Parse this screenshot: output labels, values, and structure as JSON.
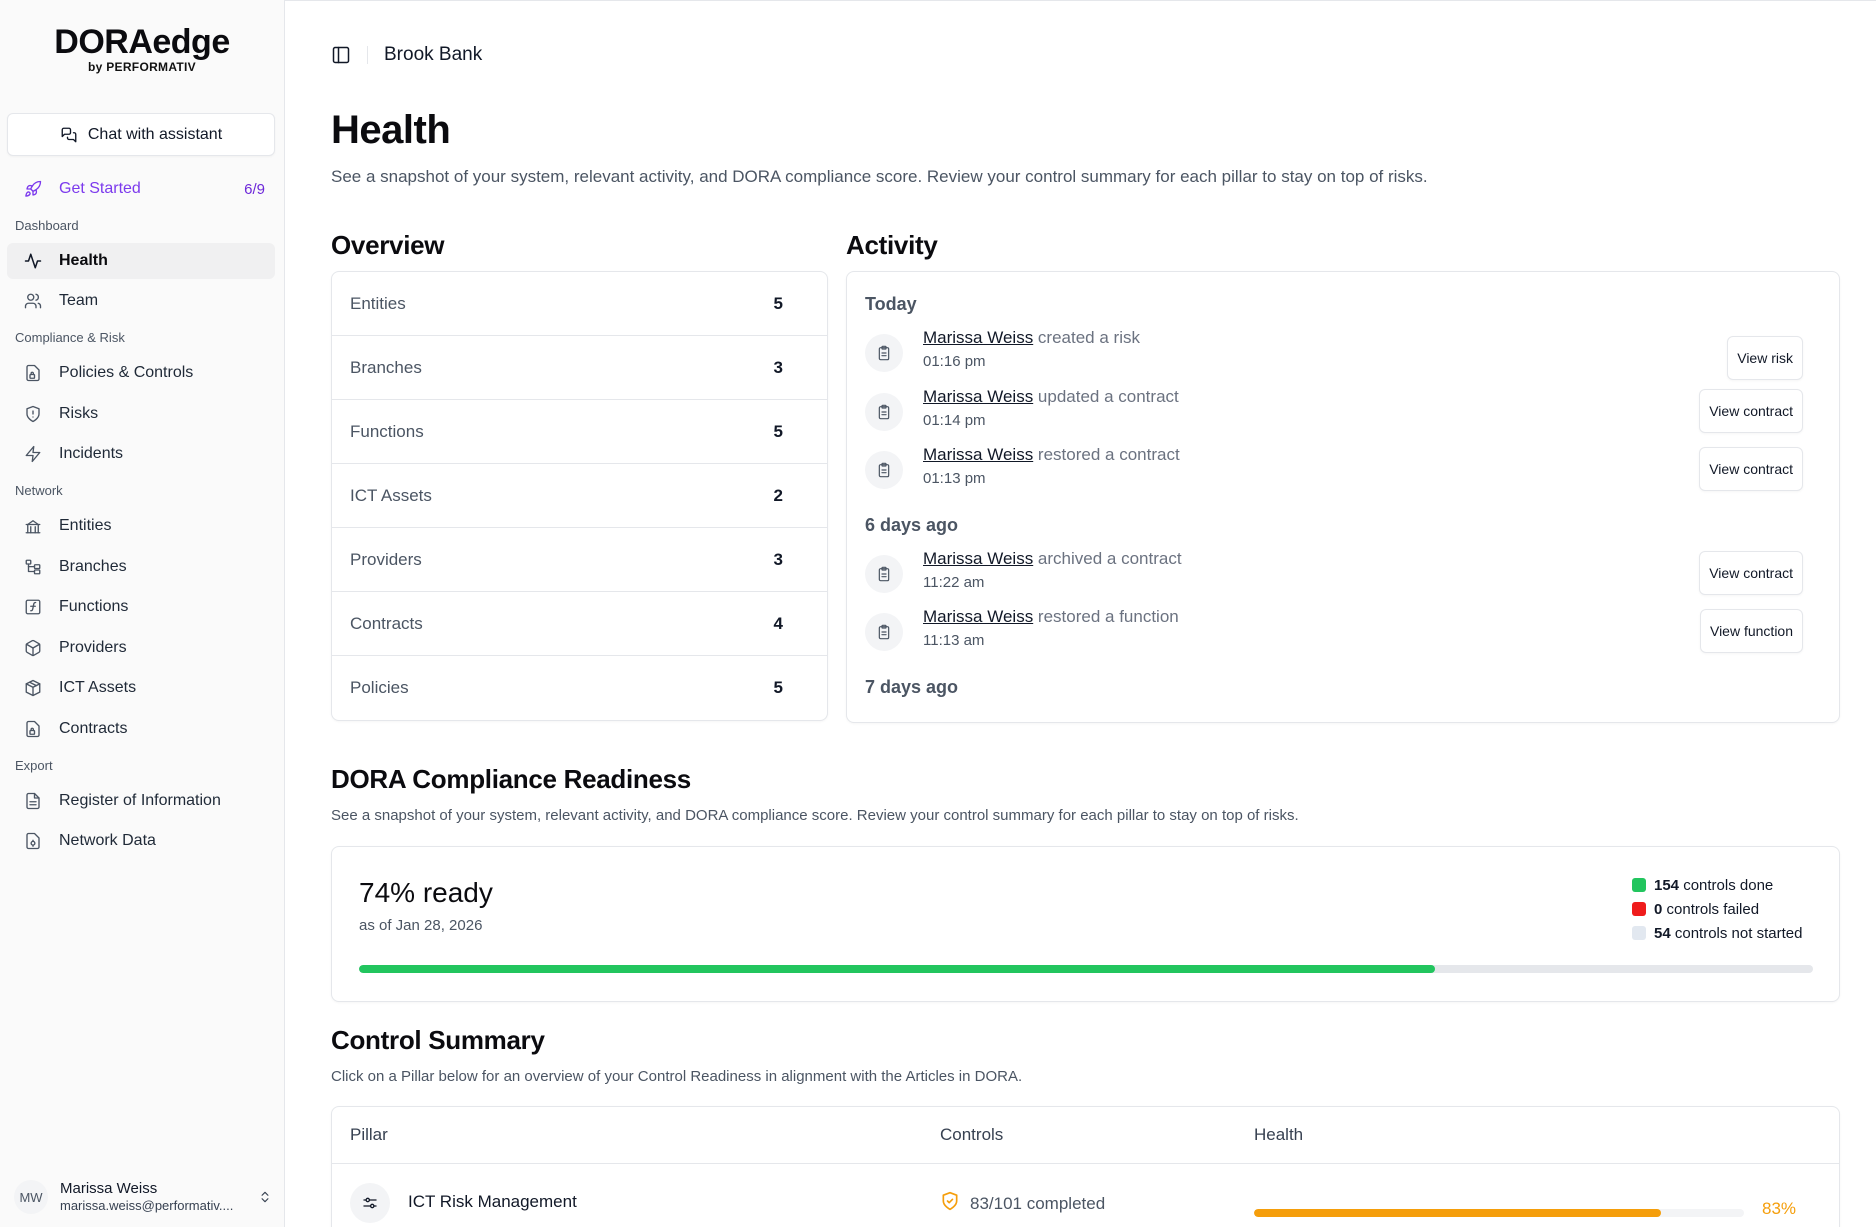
{
  "brand": {
    "name": "DORAedge",
    "byline": "by PERFORMATIV"
  },
  "sidebar": {
    "chat_label": "Chat with assistant",
    "get_started": {
      "label": "Get Started",
      "progress": "6/9"
    },
    "sections": {
      "dashboard": "Dashboard",
      "compliance": "Compliance & Risk",
      "network": "Network",
      "export": "Export"
    },
    "items": {
      "health": "Health",
      "team": "Team",
      "policies": "Policies & Controls",
      "risks": "Risks",
      "incidents": "Incidents",
      "entities": "Entities",
      "branches": "Branches",
      "functions": "Functions",
      "providers": "Providers",
      "ict_assets": "ICT Assets",
      "contracts": "Contracts",
      "register": "Register of Information",
      "network_data": "Network Data"
    },
    "user": {
      "initials": "MW",
      "name": "Marissa Weiss",
      "email": "marissa.weiss@performativ...."
    }
  },
  "header": {
    "org": "Brook Bank"
  },
  "page": {
    "title": "Health",
    "subtitle": "See a snapshot of your system, relevant activity, and DORA compliance score. Review your control summary for each pillar to stay on top of risks."
  },
  "overview": {
    "title": "Overview",
    "rows": [
      {
        "label": "Entities",
        "value": "5"
      },
      {
        "label": "Branches",
        "value": "3"
      },
      {
        "label": "Functions",
        "value": "5"
      },
      {
        "label": "ICT Assets",
        "value": "2"
      },
      {
        "label": "Providers",
        "value": "3"
      },
      {
        "label": "Contracts",
        "value": "4"
      },
      {
        "label": "Policies",
        "value": "5"
      }
    ]
  },
  "activity": {
    "title": "Activity",
    "groups": {
      "today": "Today",
      "six_days": "6 days ago",
      "seven_days": "7 days ago"
    },
    "items": [
      {
        "actor": "Marissa Weiss",
        "action": " created a risk",
        "time": "01:16 pm",
        "button": "View risk"
      },
      {
        "actor": "Marissa Weiss",
        "action": " updated a contract",
        "time": "01:14 pm",
        "button": "View contract"
      },
      {
        "actor": "Marissa Weiss",
        "action": " restored a contract",
        "time": "01:13 pm",
        "button": "View contract"
      },
      {
        "actor": "Marissa Weiss",
        "action": " archived a contract",
        "time": "11:22 am",
        "button": "View contract"
      },
      {
        "actor": "Marissa Weiss",
        "action": " restored a function",
        "time": "11:13 am",
        "button": "View function"
      }
    ]
  },
  "readiness": {
    "title": "DORA Compliance Readiness",
    "subtitle": "See a snapshot of your system, relevant activity, and DORA compliance score. Review your control summary for each pillar to stay on top of risks.",
    "ready_label": "74% ready",
    "as_of": "as of Jan 28, 2026",
    "progress_fraction": 0.74,
    "legend": [
      {
        "count": "154",
        "label": " controls done",
        "color": "#22c55e"
      },
      {
        "count": "0",
        "label": " controls failed",
        "color": "#ef1c1c"
      },
      {
        "count": "54",
        "label": " controls not started",
        "color": "#e2e8f0"
      }
    ]
  },
  "control_summary": {
    "title": "Control Summary",
    "subtitle": "Click on a Pillar below for an overview of your Control Readiness in alignment with the Articles in DORA.",
    "columns": {
      "pillar": "Pillar",
      "controls": "Controls",
      "health": "Health"
    },
    "rows": [
      {
        "pillar": "ICT Risk Management",
        "controls": "83/101 completed",
        "health_pct": "83%",
        "health_fraction": 0.83
      }
    ]
  },
  "colors": {
    "accent": "#7c3aed",
    "success": "#22c55e",
    "warning": "#f59e0b",
    "danger": "#ef1c1c"
  }
}
